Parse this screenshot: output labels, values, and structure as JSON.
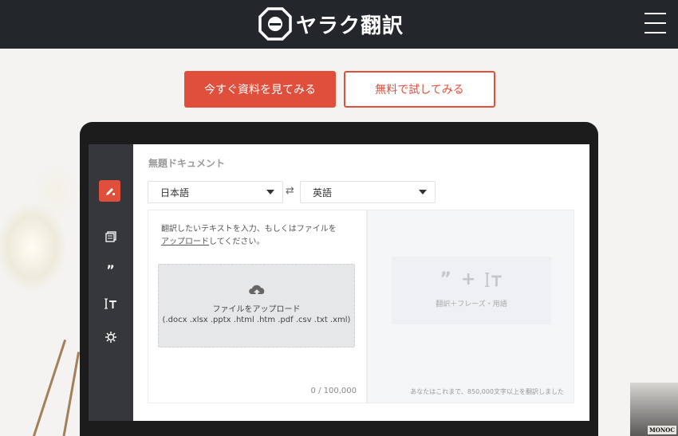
{
  "header": {
    "logo_text": "ヤラク翻訳",
    "logo_icon": "octagon-logo-icon",
    "menu_icon": "hamburger-icon"
  },
  "cta": {
    "primary_label": "今すぐ資料を見てみる",
    "secondary_label": "無料で試してみる"
  },
  "app": {
    "doc_title": "無題ドキュメント",
    "source_language": "日本語",
    "target_language": "英語",
    "swap_icon": "swap-arrows-icon",
    "sidebar_icons": [
      "edit-icon",
      "documents-icon",
      "quote-icon",
      "text-term-icon",
      "settings-gear-icon"
    ],
    "source_hint_line1": "翻訳したいテキストを入力、もしくはファイルを",
    "source_hint_link": "アップロード",
    "source_hint_line2": "してください。",
    "drop_title": "ファイルをアップロード",
    "drop_extensions": "(.docx .xlsx .pptx .html .htm .pdf .csv .txt .xml)",
    "char_counter": "0 / 100,000",
    "target_caption": "翻訳＋フレーズ・用語",
    "target_note": "あなたはこれまで、850,000文字以上を翻訳しました"
  },
  "decor": {
    "book_label": "MONOC"
  },
  "colors": {
    "brand_red": "#e04f3c",
    "topbar": "#23272c",
    "sidebar": "#35373b"
  }
}
